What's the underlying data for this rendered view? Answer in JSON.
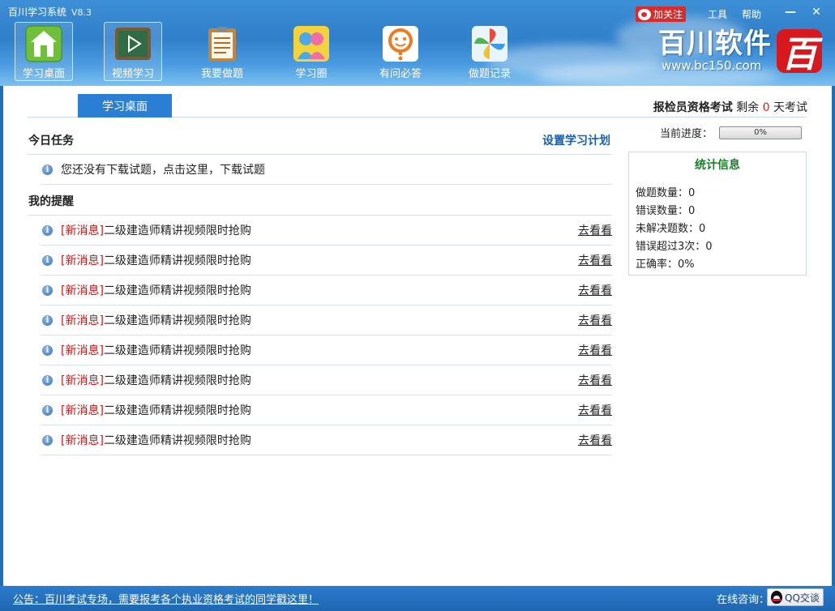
{
  "titlebar": {
    "title": "百川学习系统",
    "version": "V8.3",
    "follow_label": "加关注",
    "tools_label": "工具",
    "help_label": "帮助",
    "minimize_label": "—",
    "close_label": "✕"
  },
  "nav": {
    "items": [
      {
        "label": "学习桌面",
        "icon": "home-icon"
      },
      {
        "label": "视频学习",
        "icon": "video-icon"
      },
      {
        "label": "我要做题",
        "icon": "clipboard-icon"
      },
      {
        "label": "学习圈",
        "icon": "people-icon"
      },
      {
        "label": "有问必答",
        "icon": "question-icon"
      },
      {
        "label": "做题记录",
        "icon": "pinwheel-icon"
      }
    ]
  },
  "brand": {
    "name": "百川软件",
    "url": "www.bc150.com",
    "logo_char": "百"
  },
  "tab": {
    "label": "学习桌面"
  },
  "exam": {
    "name": "报检员资格考试",
    "remaining_prefix": "剩余",
    "days": "0",
    "days_suffix": "天考试"
  },
  "progress": {
    "label": "当前进度：",
    "value_text": "0%",
    "value": 0
  },
  "stats": {
    "title": "统计信息",
    "rows": [
      {
        "text": "做题数量：0"
      },
      {
        "text": "错误数量：0"
      },
      {
        "text": "未解决题数：0"
      },
      {
        "text": "错误超过3次：0"
      },
      {
        "text": "正确率：0%"
      }
    ]
  },
  "today": {
    "title": "今日任务",
    "plan_link": "设置学习计划",
    "message": "您还没有下载试题，点击这里，下载试题"
  },
  "reminders": {
    "title": "我的提醒",
    "items": [
      {
        "tag": "[新消息]",
        "text": "二级建造师精讲视频限时抢购",
        "action": "去看看"
      },
      {
        "tag": "[新消息]",
        "text": "二级建造师精讲视频限时抢购",
        "action": "去看看"
      },
      {
        "tag": "[新消息]",
        "text": "二级建造师精讲视频限时抢购",
        "action": "去看看"
      },
      {
        "tag": "[新消息]",
        "text": "二级建造师精讲视频限时抢购",
        "action": "去看看"
      },
      {
        "tag": "[新消息]",
        "text": "二级建造师精讲视频限时抢购",
        "action": "去看看"
      },
      {
        "tag": "[新消息]",
        "text": "二级建造师精讲视频限时抢购",
        "action": "去看看"
      },
      {
        "tag": "[新消息]",
        "text": "二级建造师精讲视频限时抢购",
        "action": "去看看"
      },
      {
        "tag": "[新消息]",
        "text": "二级建造师精讲视频限时抢购",
        "action": "去看看"
      }
    ]
  },
  "footer": {
    "notice": "公告：百川考试专场，需要报考各个执业资格考试的同学戳这里！",
    "consult_label": "在线咨询：",
    "qq_label": "QQ交谈"
  },
  "colors": {
    "header_blue": "#2f7fca",
    "accent_red": "#d82b2b",
    "stats_title_green": "#1b7e2b",
    "link_blue": "#1a5fa8"
  }
}
